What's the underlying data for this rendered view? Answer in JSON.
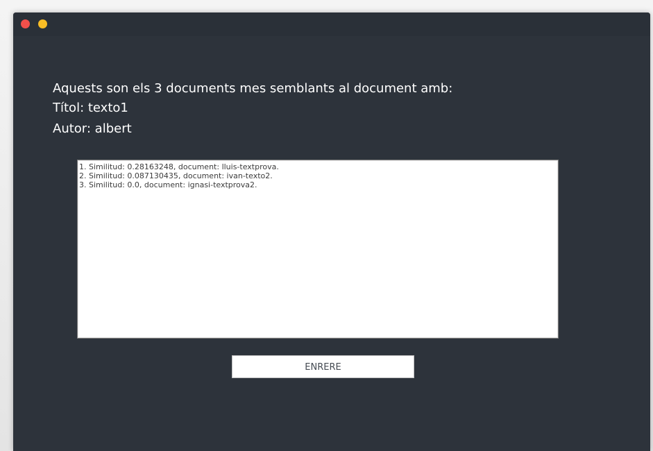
{
  "window": {
    "controls": [
      "close",
      "minimize"
    ]
  },
  "header": {
    "line1": "Aquests son els 3 documents mes semblants al document amb:",
    "line2": "Títol: texto1",
    "line3": "Autor: albert"
  },
  "results": {
    "items": [
      "1. Similitud: 0.28163248, document: lluis-textprova.",
      "2. Similitud: 0.087130435, document: ivan-texto2.",
      "3. Similitud: 0.0, document: ignasi-textprova2."
    ]
  },
  "actions": {
    "back_label": "ENRERE"
  },
  "colors": {
    "window_bg": "#2d333b",
    "close": "#f2504b",
    "minimize": "#f9bd25",
    "text": "#ffffff"
  }
}
